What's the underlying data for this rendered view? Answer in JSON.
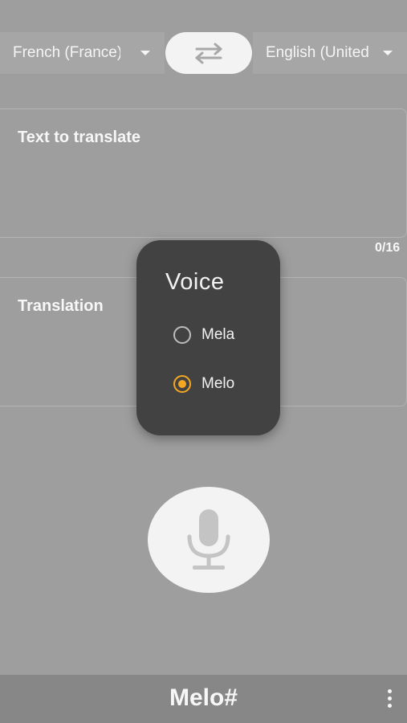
{
  "language_bar": {
    "source_language": "French (France)",
    "target_language": "English (United States)"
  },
  "source_card": {
    "label": "Text to translate",
    "char_counter": "0/16"
  },
  "translation_card": {
    "label": "Translation"
  },
  "voice_dialog": {
    "title": "Voice",
    "options": [
      {
        "label": "Mela",
        "selected": false
      },
      {
        "label": "Melo",
        "selected": true
      }
    ]
  },
  "bottom_bar": {
    "app_title": "Melo#"
  },
  "icons": {
    "swap": "swap-arrows-icon",
    "mic": "microphone-icon",
    "more": "more-vertical-icon",
    "dropdown": "dropdown-arrow-icon"
  },
  "colors": {
    "accent": "#f5a623",
    "dialog_bg": "#424242",
    "background": "#9e9e9e",
    "bottom_bar": "#878787"
  }
}
